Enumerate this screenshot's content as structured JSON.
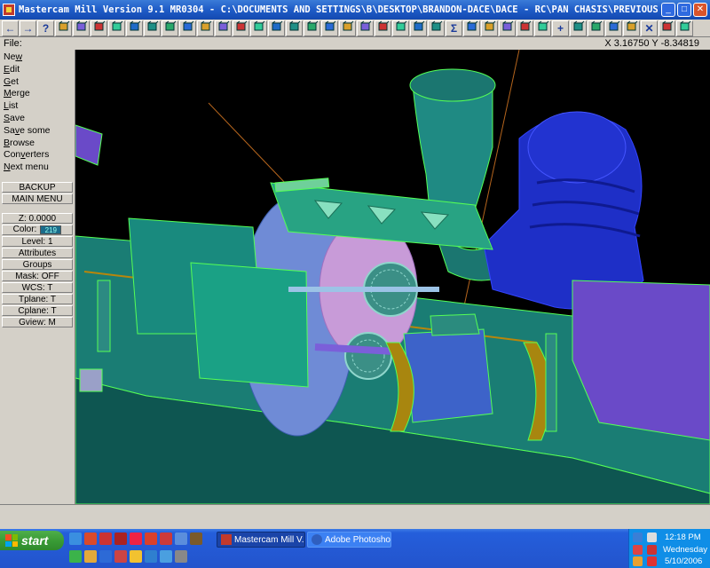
{
  "window": {
    "title": "Mastercam Mill Version 9.1 MR0304 - C:\\DOCUMENTS AND SETTINGS\\B\\DESKTOP\\BRANDON-DACE\\DACE - RC\\PAN CHASIS\\PREVIOUS VERSIONS\\PAN CONV..."
  },
  "toolbar": {
    "icons": [
      "left-arrow-icon",
      "right-arrow-icon",
      "help-icon",
      "notepad-icon",
      "zoom-help-icon",
      "zoom-icon",
      "zoom-out-icon",
      "zoom-window-icon",
      "pan-icon",
      "fit-icon",
      "view-top-icon",
      "view-front-icon",
      "view-side-icon",
      "view-iso-icon",
      "cube-icon",
      "cube-blue-icon",
      "cube-outline-icon",
      "cube-white-icon",
      "pencil-icon",
      "no-icon",
      "layers-icon",
      "link-icon",
      "rotate-icon",
      "sphere-icon",
      "refresh-icon",
      "sigma-icon",
      "line-icon",
      "arc-icon",
      "curve-icon",
      "spline-icon",
      "rectangle-icon",
      "plus-icon",
      "diamond-icon",
      "box-icon",
      "cylinder-icon",
      "chevron-icon",
      "x-icon",
      "tri-icon",
      "down-tri-icon"
    ]
  },
  "statusbar": {
    "file_label": "File:",
    "coords": "X 3.16750  Y -8.34819"
  },
  "menu": {
    "items": [
      {
        "pre": "Ne",
        "u": "w",
        "post": ""
      },
      {
        "pre": "",
        "u": "E",
        "post": "dit"
      },
      {
        "pre": "",
        "u": "G",
        "post": "et"
      },
      {
        "pre": "",
        "u": "M",
        "post": "erge"
      },
      {
        "pre": "",
        "u": "L",
        "post": "ist"
      },
      {
        "pre": "",
        "u": "S",
        "post": "ave"
      },
      {
        "pre": "Sa",
        "u": "v",
        "post": "e some"
      },
      {
        "pre": "",
        "u": "B",
        "post": "rowse"
      },
      {
        "pre": "Con",
        "u": "v",
        "post": "erters"
      },
      {
        "pre": "",
        "u": "N",
        "post": "ext menu"
      }
    ],
    "backup": "BACKUP",
    "main_menu": "MAIN MENU",
    "z": "Z:  0.0000",
    "color_label": "Color:",
    "color_value": "219",
    "level": "Level:  1",
    "attributes": "Attributes",
    "groups": "Groups",
    "mask": "Mask:  OFF",
    "wcs": "WCS:  T",
    "tplane": "Tplane:  T",
    "cplane": "Cplane:  T",
    "gview": "Gview:  M"
  },
  "taskbar": {
    "start": "start",
    "tasks": [
      {
        "label": "Mastercam Mill V...",
        "active": true
      },
      {
        "label": "Adobe Photoshop",
        "active": false
      }
    ],
    "time": "12:18 PM",
    "day": "Wednesday",
    "date": "5/10/2006"
  },
  "colors": {
    "accent": "#245edb",
    "chassis": "#1f8f86",
    "engine_blue": "#1e2fc7",
    "servo": "#3d63c9",
    "purple": "#6a4ac8",
    "outline": "#55ff55"
  }
}
